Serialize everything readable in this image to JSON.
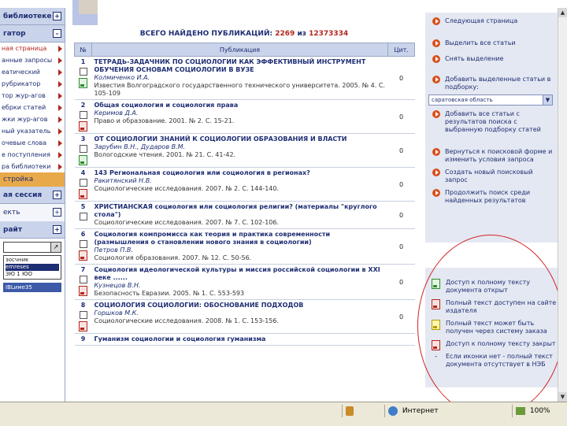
{
  "left_nav": {
    "items": [
      {
        "type": "head",
        "label": "библиотеке",
        "box": "+"
      },
      {
        "type": "head",
        "label": "гатор",
        "box": "–"
      },
      {
        "type": "sub-red",
        "label": "ная страница"
      },
      {
        "type": "sub",
        "label": "анные запросы"
      },
      {
        "type": "sub",
        "label": "еатический"
      },
      {
        "type": "sub",
        "label": "рубрикатор"
      },
      {
        "type": "sub",
        "label": "тор жур-агов"
      },
      {
        "type": "sub",
        "label": "ебрки статей"
      },
      {
        "type": "sub",
        "label": "жки жур-агов"
      },
      {
        "type": "sub",
        "label": "ный указатель"
      },
      {
        "type": "sub",
        "label": "очевые слова"
      },
      {
        "type": "sub",
        "label": "е поступления"
      },
      {
        "type": "sub",
        "label": "ра библиотеки"
      },
      {
        "type": "orange",
        "label": "стройка"
      },
      {
        "type": "head",
        "label": "ая сессия",
        "box": "+"
      },
      {
        "type": "plain",
        "label": "екть",
        "box": "+"
      },
      {
        "type": "head",
        "label": "райт",
        "box": "+"
      }
    ],
    "list_items": [
      "зосчник",
      "emreses",
      "ЗЮ 1 ЮО"
    ],
    "logo_text": "IBLиме35"
  },
  "main": {
    "found_label": "ВСЕГО НАЙДЕНО ПУБЛИКАЦИЙ:",
    "found_count": "2269",
    "found_of": "из",
    "found_total": "12373334",
    "col_num": "№",
    "col_pub": "Публикация",
    "col_cit": "Цит.",
    "rows": [
      {
        "num": "1",
        "title": "ТЕТРАДЬ-ЗАДАЧНИК ПО СОЦИОЛОГИИ КАК ЭФФЕКТИВНЫЙ ИНСТРУМЕНТ ОБУЧЕНИЯ ОСНОВАМ СОЦИОЛОГИИ В ВУЗЕ",
        "author": "Колмиченко И.А.",
        "src": "Известия Волгоградского государственного технического университета. 2005. № 4. С. 105-109",
        "cit": "0",
        "icon": "green"
      },
      {
        "num": "2",
        "title": "Общая социология и социология права",
        "author": "Керимов Д.А.",
        "src": "Право и образование. 2001. № 2. С. 15-21.",
        "cit": "0",
        "icon": "red"
      },
      {
        "num": "3",
        "title": "ОТ СОЦИОЛОГИИ ЗНАНИЙ К СОЦИОЛОГИИ ОБРАЗОВАНИЯ И ВЛАСТИ",
        "author": "Зарубин В.Н., Дударов В.М.",
        "src": "Вологодские чтения. 2001. № 21. С. 41-42.",
        "cit": "0",
        "icon": "green"
      },
      {
        "num": "4",
        "title": "143 Региональная социология или социология в регионах?",
        "author": "Ракитянский Н.В.",
        "src": "Социологические исследования. 2007. № 2. С. 144-140.",
        "cit": "0",
        "icon": "red"
      },
      {
        "num": "5",
        "title": "ХРИСТИАНСКАЯ социология или социология религии? (материалы \"круглого стола\")",
        "author": "",
        "src": "Социологические исследования. 2007. № 7. С. 102-106.",
        "cit": "0",
        "icon": "none"
      },
      {
        "num": "6",
        "title": "Социология компромисса как теория и практика современности (размышления о становлении нового знания в социологии)",
        "author": "Петров П.В.",
        "src": "Социология образования. 2007. № 12. С. 50-56.",
        "cit": "0",
        "icon": "red"
      },
      {
        "num": "7",
        "title": "Социология идеологической культуры и миссия российской социологии в XXI веке ......",
        "author": "Кузнецов В.Н.",
        "src": "Безопасность Евразии. 2005. № 1. С. 553-593",
        "cit": "0",
        "icon": "red"
      },
      {
        "num": "8",
        "title": "СОЦИОЛОГИЯ СОЦИОЛОГИИ: ОБОСНОВАНИЕ ПОДХОДОВ",
        "author": "Горшков М.К.",
        "src": "Социологические исследования. 2008. № 1. С. 153-156.",
        "cit": "0",
        "icon": "red"
      },
      {
        "num": "9",
        "title": "Гуманизм социологии и социология гуманизма",
        "author": "",
        "src": "",
        "cit": "",
        "icon": "none"
      }
    ]
  },
  "right_panel": {
    "actions_top": [
      "Следующая страница"
    ],
    "actions_mid": [
      "Выделить все статьи",
      "Снять выделение",
      "Добавить выделенные статьи в подборку:"
    ],
    "select_value": "саратовская область",
    "actions_after": [
      "Добавить все статьи с результатов поиска с выбранную подборку статей"
    ],
    "actions_bottom": [
      "Вернуться к поисковой форме и изменить условия запроса",
      "Создать новый поисковый запрос",
      "Продолжить поиск среди найденных результатов"
    ]
  },
  "legend": {
    "items": [
      {
        "icon": "green",
        "label": "Доступ к полному тексту документа открыт"
      },
      {
        "icon": "red",
        "label": "Полный текст доступен на сайте издателя"
      },
      {
        "icon": "yellow",
        "label": "Полный текст может быть получен через систему заказа"
      },
      {
        "icon": "red",
        "label": "Доступ к полному тексту закрыт"
      },
      {
        "icon": "dash",
        "label": "Если иконки нет - полный текст документа отсутствует в НЭБ"
      }
    ]
  },
  "status": {
    "zone": "Интернет",
    "zoom": "100%"
  },
  "colors": {
    "accent": "#1e2e73",
    "highlight": "#b3261e",
    "ellipse": "#d42424"
  }
}
